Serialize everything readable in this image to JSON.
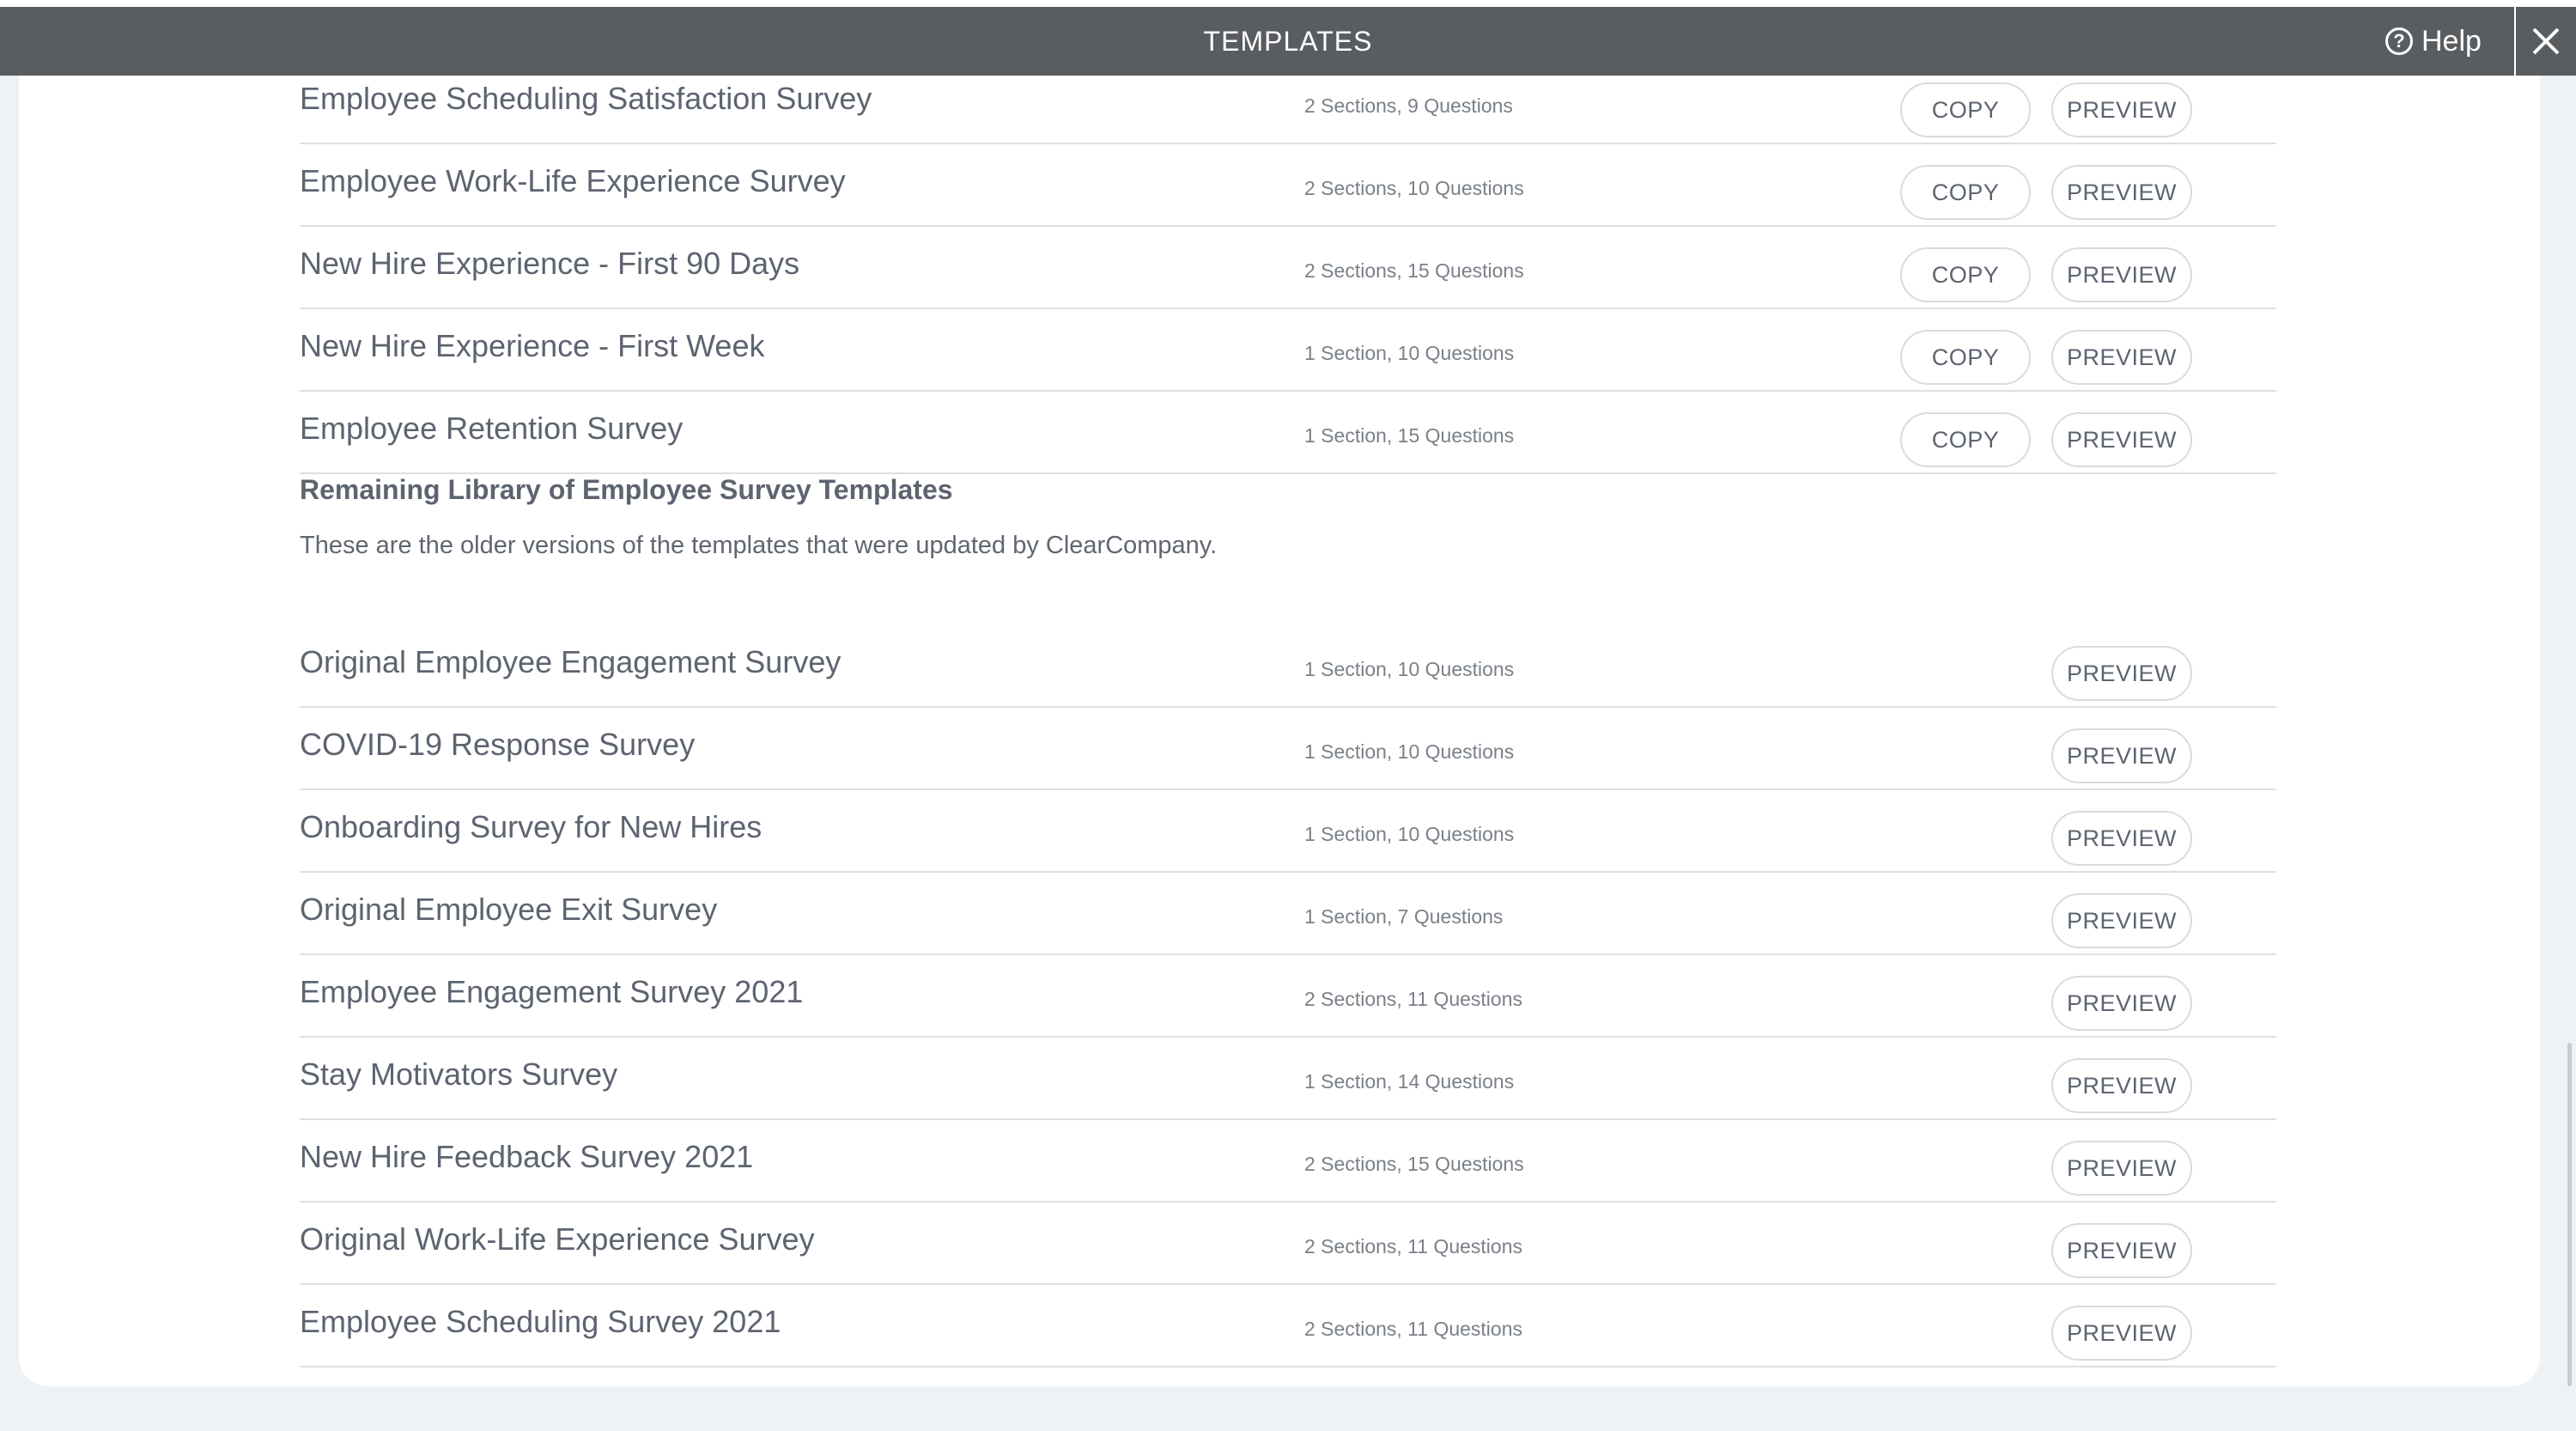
{
  "header": {
    "title": "TEMPLATES",
    "help_label": "Help"
  },
  "updated_templates": [
    {
      "name": "Employee Scheduling Satisfaction Survey",
      "meta": "2 Sections, 9 Questions",
      "copy": "COPY",
      "preview": "PREVIEW"
    },
    {
      "name": "Employee Work-Life Experience Survey",
      "meta": "2 Sections, 10 Questions",
      "copy": "COPY",
      "preview": "PREVIEW"
    },
    {
      "name": "New Hire Experience - First 90 Days",
      "meta": "2 Sections, 15 Questions",
      "copy": "COPY",
      "preview": "PREVIEW"
    },
    {
      "name": "New Hire Experience - First Week",
      "meta": "1 Section, 10 Questions",
      "copy": "COPY",
      "preview": "PREVIEW"
    },
    {
      "name": "Employee Retention Survey",
      "meta": "1 Section, 15 Questions",
      "copy": "COPY",
      "preview": "PREVIEW"
    }
  ],
  "remaining_section": {
    "title": "Remaining Library of Employee Survey Templates",
    "description": "These are the older versions of the templates that were updated by ClearCompany."
  },
  "remaining_templates": [
    {
      "name": "Original Employee Engagement Survey",
      "meta": "1 Section, 10 Questions",
      "preview": "PREVIEW"
    },
    {
      "name": "COVID-19 Response Survey",
      "meta": "1 Section, 10 Questions",
      "preview": "PREVIEW"
    },
    {
      "name": "Onboarding Survey for New Hires",
      "meta": "1 Section, 10 Questions",
      "preview": "PREVIEW"
    },
    {
      "name": "Original Employee Exit Survey",
      "meta": "1 Section, 7 Questions",
      "preview": "PREVIEW"
    },
    {
      "name": "Employee Engagement Survey 2021",
      "meta": "2 Sections, 11 Questions",
      "preview": "PREVIEW"
    },
    {
      "name": "Stay Motivators Survey",
      "meta": "1 Section, 14 Questions",
      "preview": "PREVIEW"
    },
    {
      "name": "New Hire Feedback Survey 2021",
      "meta": "2 Sections, 15 Questions",
      "preview": "PREVIEW"
    },
    {
      "name": "Original Work-Life Experience Survey",
      "meta": "2 Sections, 11 Questions",
      "preview": "PREVIEW"
    },
    {
      "name": "Employee Scheduling Survey 2021",
      "meta": "2 Sections, 11 Questions",
      "preview": "PREVIEW"
    }
  ]
}
